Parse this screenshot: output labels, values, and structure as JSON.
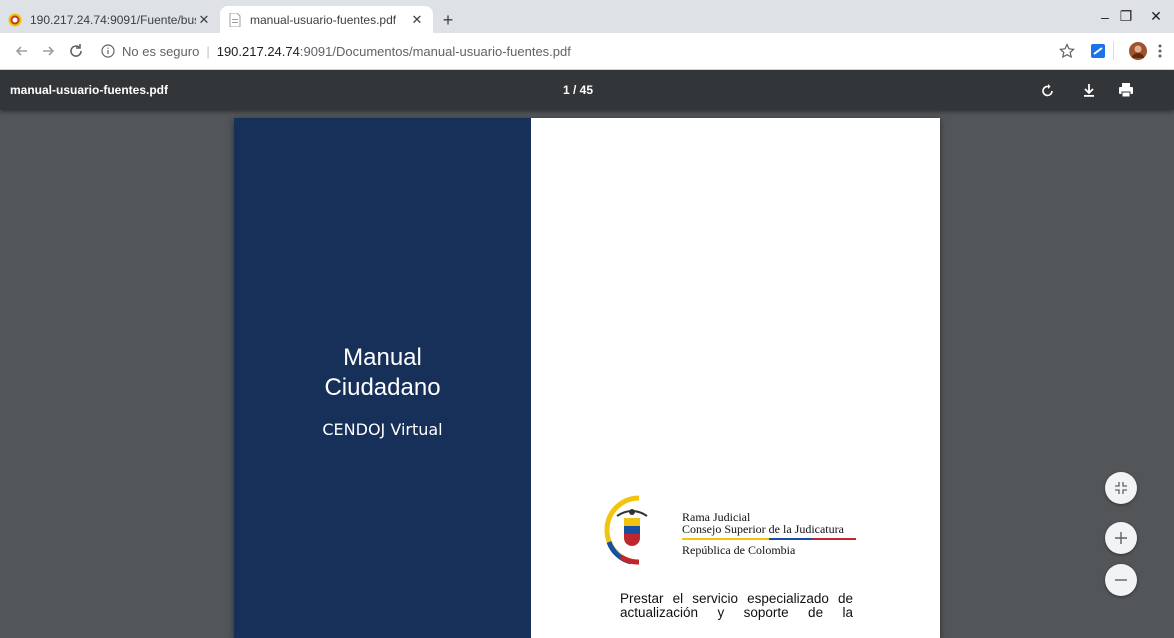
{
  "browser": {
    "tabs": [
      {
        "title": "190.217.24.74:9091/Fuente/busc",
        "active": false
      },
      {
        "title": "manual-usuario-fuentes.pdf",
        "active": true
      }
    ],
    "new_tab": "+",
    "window_controls": {
      "minimize": "–",
      "restore": "❐",
      "close": "✕"
    },
    "address": {
      "security": "No es seguro",
      "host": "190.217.24.74",
      "path": ":9091/Documentos/manual-usuario-fuentes.pdf"
    },
    "icons": [
      "back-arrow-icon",
      "forward-arrow-icon",
      "reload-icon",
      "info-icon",
      "bookmark-star-icon",
      "extension-icon",
      "profile-avatar-icon",
      "menu-kebab-icon"
    ]
  },
  "pdf_viewer": {
    "filename": "manual-usuario-fuentes.pdf",
    "page_indicator": "1 / 45",
    "page": {
      "title_line1": "Manual",
      "title_line2": "Ciudadano",
      "subtitle": "CENDOJ Virtual",
      "org_line1": "Rama Judicial",
      "org_line2": "Consejo Superior de la Judicatura",
      "org_line3": "República de Colombia",
      "paragraph_line1": "Prestar el servicio especializado de",
      "paragraph_line2": "actualización y soporte de la"
    },
    "colors": {
      "cover_blue": "#17305a",
      "toolbar": "#323639",
      "background": "#525659"
    }
  }
}
